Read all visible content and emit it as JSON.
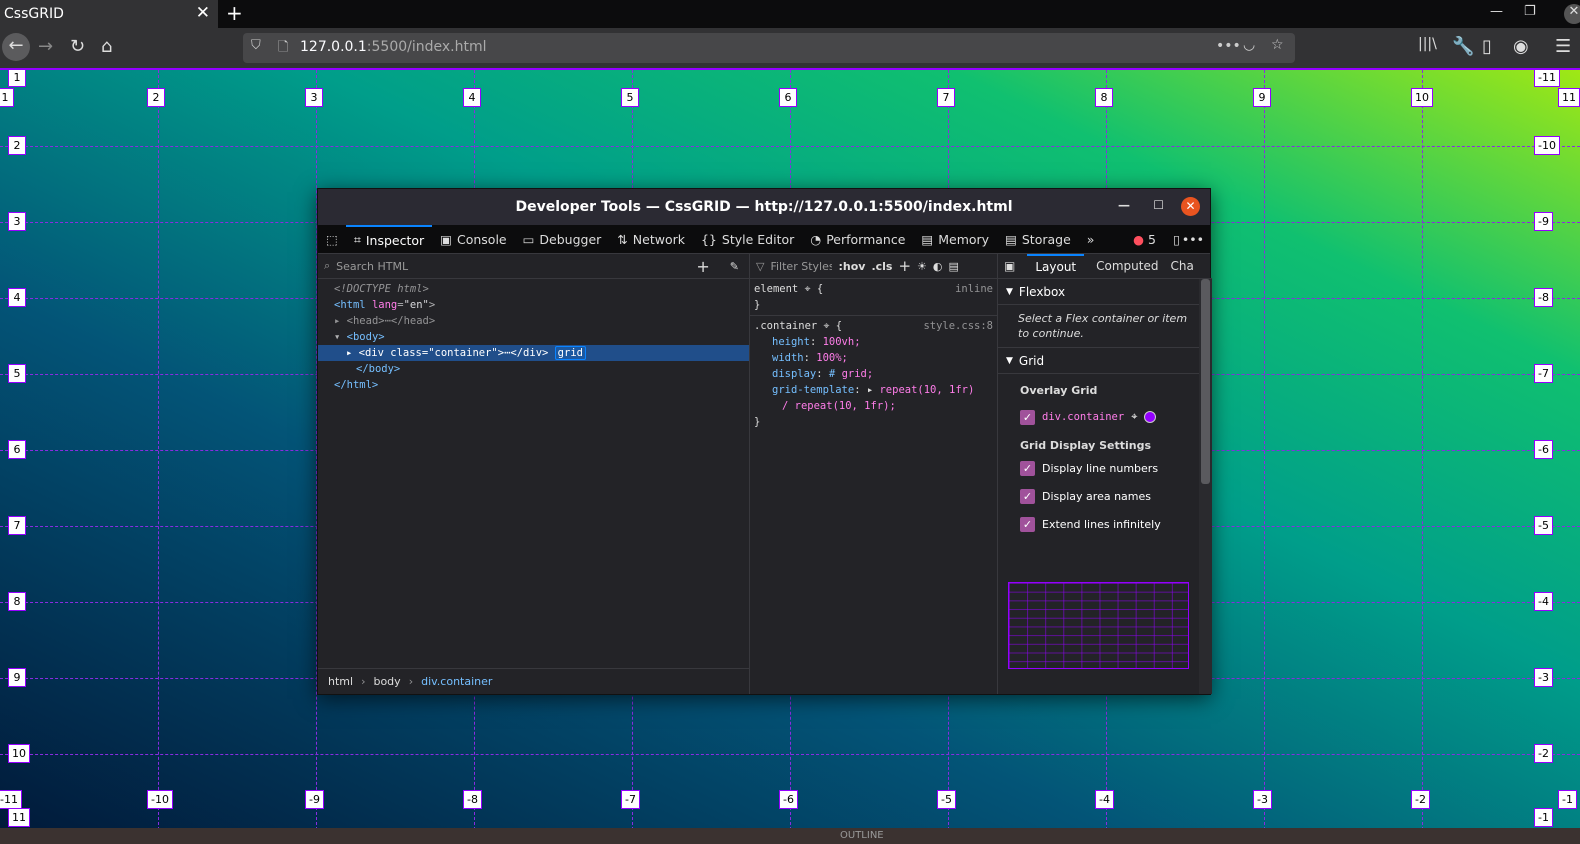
{
  "browser": {
    "tab_title": "CssGRID",
    "url_host": "127.0.0.1",
    "url_rest": ":5500/index.html"
  },
  "grid_overlay": {
    "top_col_labels": [
      "1",
      "2",
      "3",
      "4",
      "5",
      "6",
      "7",
      "8",
      "9",
      "10",
      "11"
    ],
    "bottom_col_labels": [
      "-11",
      "-10",
      "-9",
      "-8",
      "-7",
      "-6",
      "-5",
      "-4",
      "-3",
      "-2",
      "-1"
    ],
    "left_row_labels": [
      "1",
      "2",
      "3",
      "4",
      "5",
      "6",
      "7",
      "8",
      "9",
      "10",
      "11"
    ],
    "right_row_labels": [
      "-11",
      "-10",
      "-9",
      "-8",
      "-7",
      "-6",
      "-5",
      "-4",
      "-3",
      "-2",
      "-1"
    ],
    "line_color": "#9400ff"
  },
  "devtools": {
    "title": "Developer Tools — CssGRID — http://127.0.0.1:5500/index.html",
    "tabs": [
      "Inspector",
      "Console",
      "Debugger",
      "Network",
      "Style Editor",
      "Performance",
      "Memory",
      "Storage"
    ],
    "error_count": "5",
    "search_placeholder": "Search HTML",
    "markup": {
      "doctype": "<!DOCTYPE html>",
      "html_open_tag": "<html",
      "lang_attr": "lang",
      "lang_val": "\"en\"",
      "head": "<head>",
      "head_close": "</head>",
      "body": "<body>",
      "div_open": "<div ",
      "div_class_attr": "class",
      "div_class_val": "\"container\"",
      "div_close": "</div>",
      "grid_badge": "grid",
      "body_close": "</body>",
      "html_close": "</html>"
    },
    "breadcrumbs": [
      "html",
      "body",
      "div.container"
    ],
    "rules": {
      "filter_placeholder": "Filter Styles",
      "hov": ":hov",
      "cls": ".cls",
      "element_selector": "element",
      "element_source": "inline",
      "selector": ".container",
      "source": "style.css:8",
      "decls": [
        {
          "p": "height",
          "v": "100vh;"
        },
        {
          "p": "width",
          "v": "100%;"
        },
        {
          "p": "display",
          "v": "grid;"
        },
        {
          "p": "grid-template",
          "v": "repeat(10, 1fr)"
        }
      ],
      "cont": "/ repeat(10, 1fr);"
    },
    "layout": {
      "tabs": [
        "Layout",
        "Computed",
        "Cha"
      ],
      "flexbox": "Flexbox",
      "flex_msg": "Select a Flex container or item to continue.",
      "grid": "Grid",
      "overlay_grid": "Overlay Grid",
      "container": "div.container",
      "overlay_color": "#9400ff",
      "display_settings": "Grid Display Settings",
      "options": [
        "Display line numbers",
        "Display area names",
        "Extend lines infinitely"
      ]
    }
  },
  "bottom_strip": "OUTLINE"
}
